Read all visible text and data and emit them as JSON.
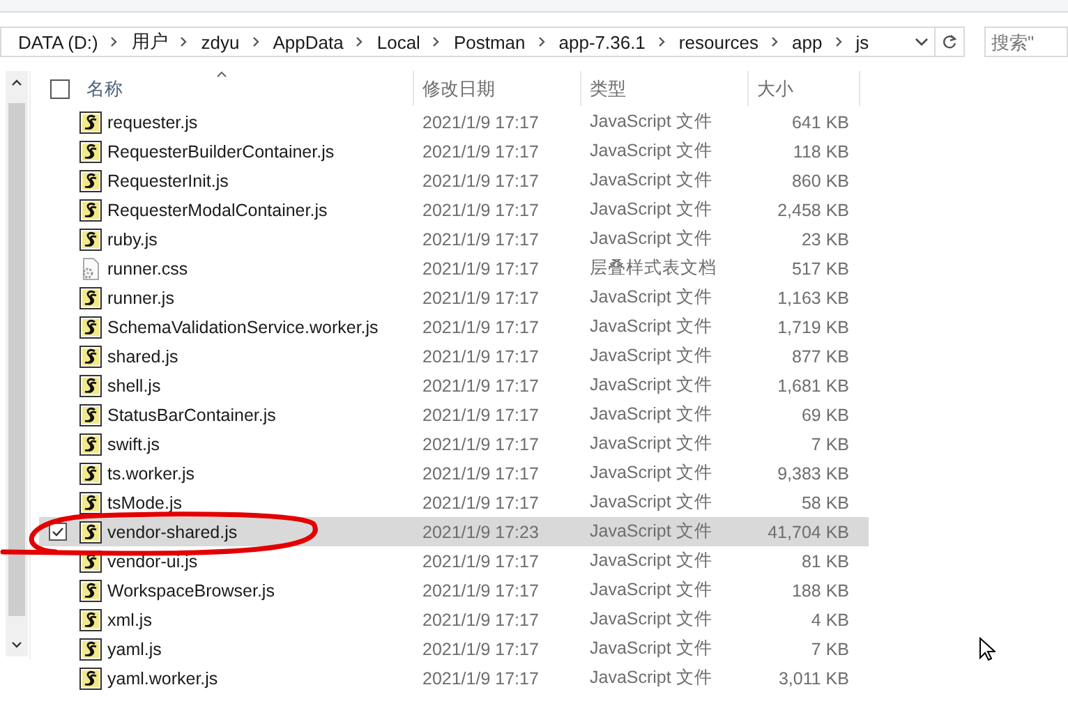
{
  "breadcrumb": [
    "DATA (D:)",
    "用户",
    "zdyu",
    "AppData",
    "Local",
    "Postman",
    "app-7.36.1",
    "resources",
    "app",
    "js"
  ],
  "search": {
    "placeholder": "搜索\""
  },
  "columns": [
    "名称",
    "修改日期",
    "类型",
    "大小"
  ],
  "select_all": {
    "checked": false
  },
  "rows": [
    {
      "name": "requester.js",
      "kind": "js",
      "date": "2021/1/9 17:17",
      "type": "JavaScript 文件",
      "size": "641 KB",
      "selected": false
    },
    {
      "name": "RequesterBuilderContainer.js",
      "kind": "js",
      "date": "2021/1/9 17:17",
      "type": "JavaScript 文件",
      "size": "118 KB",
      "selected": false
    },
    {
      "name": "RequesterInit.js",
      "kind": "js",
      "date": "2021/1/9 17:17",
      "type": "JavaScript 文件",
      "size": "860 KB",
      "selected": false
    },
    {
      "name": "RequesterModalContainer.js",
      "kind": "js",
      "date": "2021/1/9 17:17",
      "type": "JavaScript 文件",
      "size": "2,458 KB",
      "selected": false
    },
    {
      "name": "ruby.js",
      "kind": "js",
      "date": "2021/1/9 17:17",
      "type": "JavaScript 文件",
      "size": "23 KB",
      "selected": false
    },
    {
      "name": "runner.css",
      "kind": "css",
      "date": "2021/1/9 17:17",
      "type": "层叠样式表文档",
      "size": "517 KB",
      "selected": false
    },
    {
      "name": "runner.js",
      "kind": "js",
      "date": "2021/1/9 17:17",
      "type": "JavaScript 文件",
      "size": "1,163 KB",
      "selected": false
    },
    {
      "name": "SchemaValidationService.worker.js",
      "kind": "js",
      "date": "2021/1/9 17:17",
      "type": "JavaScript 文件",
      "size": "1,719 KB",
      "selected": false
    },
    {
      "name": "shared.js",
      "kind": "js",
      "date": "2021/1/9 17:17",
      "type": "JavaScript 文件",
      "size": "877 KB",
      "selected": false
    },
    {
      "name": "shell.js",
      "kind": "js",
      "date": "2021/1/9 17:17",
      "type": "JavaScript 文件",
      "size": "1,681 KB",
      "selected": false
    },
    {
      "name": "StatusBarContainer.js",
      "kind": "js",
      "date": "2021/1/9 17:17",
      "type": "JavaScript 文件",
      "size": "69 KB",
      "selected": false
    },
    {
      "name": "swift.js",
      "kind": "js",
      "date": "2021/1/9 17:17",
      "type": "JavaScript 文件",
      "size": "7 KB",
      "selected": false
    },
    {
      "name": "ts.worker.js",
      "kind": "js",
      "date": "2021/1/9 17:17",
      "type": "JavaScript 文件",
      "size": "9,383 KB",
      "selected": false
    },
    {
      "name": "tsMode.js",
      "kind": "js",
      "date": "2021/1/9 17:17",
      "type": "JavaScript 文件",
      "size": "58 KB",
      "selected": false
    },
    {
      "name": "vendor-shared.js",
      "kind": "js",
      "date": "2021/1/9 17:23",
      "type": "JavaScript 文件",
      "size": "41,704 KB",
      "selected": true
    },
    {
      "name": "vendor-ui.js",
      "kind": "js",
      "date": "2021/1/9 17:17",
      "type": "JavaScript 文件",
      "size": "81 KB",
      "selected": false
    },
    {
      "name": "WorkspaceBrowser.js",
      "kind": "js",
      "date": "2021/1/9 17:17",
      "type": "JavaScript 文件",
      "size": "188 KB",
      "selected": false
    },
    {
      "name": "xml.js",
      "kind": "js",
      "date": "2021/1/9 17:17",
      "type": "JavaScript 文件",
      "size": "4 KB",
      "selected": false
    },
    {
      "name": "yaml.js",
      "kind": "js",
      "date": "2021/1/9 17:17",
      "type": "JavaScript 文件",
      "size": "7 KB",
      "selected": false
    },
    {
      "name": "yaml.worker.js",
      "kind": "js",
      "date": "2021/1/9 17:17",
      "type": "JavaScript 文件",
      "size": "3,011 KB",
      "selected": false
    }
  ]
}
